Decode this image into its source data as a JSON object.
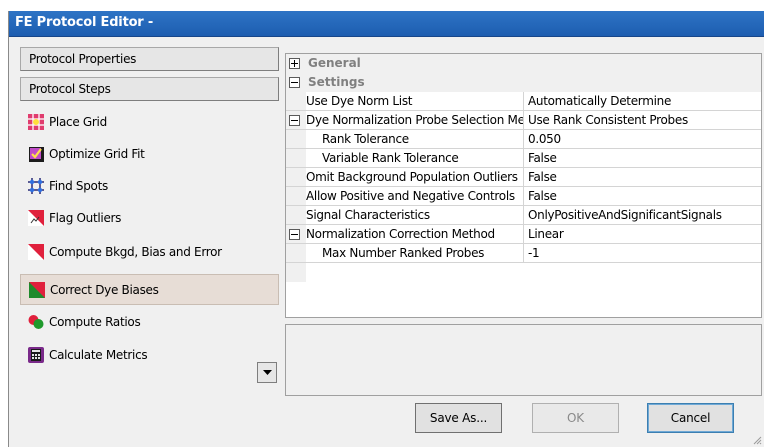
{
  "window": {
    "title": "FE Protocol Editor -"
  },
  "sidebar": {
    "protocol_properties": "Protocol Properties",
    "protocol_steps": "Protocol Steps",
    "steps": [
      {
        "label": "Place Grid",
        "icon": "place-grid-icon"
      },
      {
        "label": "Optimize Grid Fit",
        "icon": "optimize-grid-fit-icon"
      },
      {
        "label": "Find Spots",
        "icon": "find-spots-icon"
      },
      {
        "label": "Flag Outliers",
        "icon": "flag-outliers-icon"
      },
      {
        "label": "Compute Bkgd, Bias and Error",
        "icon": "compute-bkgd-icon"
      },
      {
        "label": "Correct Dye Biases",
        "icon": "correct-dye-biases-icon",
        "selected": true
      },
      {
        "label": "Compute Ratios",
        "icon": "compute-ratios-icon"
      },
      {
        "label": "Calculate Metrics",
        "icon": "calculate-metrics-icon"
      }
    ]
  },
  "property_grid": {
    "categories": {
      "general": "General",
      "settings": "Settings"
    },
    "rows": [
      {
        "name": "Use Dye Norm List",
        "value": "Automatically Determine"
      },
      {
        "name": "Dye Normalization Probe Selection Method",
        "value": "Use Rank Consistent Probes"
      },
      {
        "name": "Rank Tolerance",
        "value": "0.050"
      },
      {
        "name": "Variable Rank Tolerance",
        "value": "False"
      },
      {
        "name": "Omit Background Population Outliers",
        "value": "False"
      },
      {
        "name": "Allow Positive and Negative Controls",
        "value": "False"
      },
      {
        "name": "Signal Characteristics",
        "value": "OnlyPositiveAndSignificantSignals"
      },
      {
        "name": "Normalization Correction Method",
        "value": "Linear"
      },
      {
        "name": "Max Number Ranked Probes",
        "value": "-1"
      }
    ]
  },
  "buttons": {
    "save_as": "Save As...",
    "ok": "OK",
    "cancel": "Cancel"
  },
  "colors": {
    "titlebar": "#1d5db0",
    "selected_step": "#e7ddd6"
  }
}
